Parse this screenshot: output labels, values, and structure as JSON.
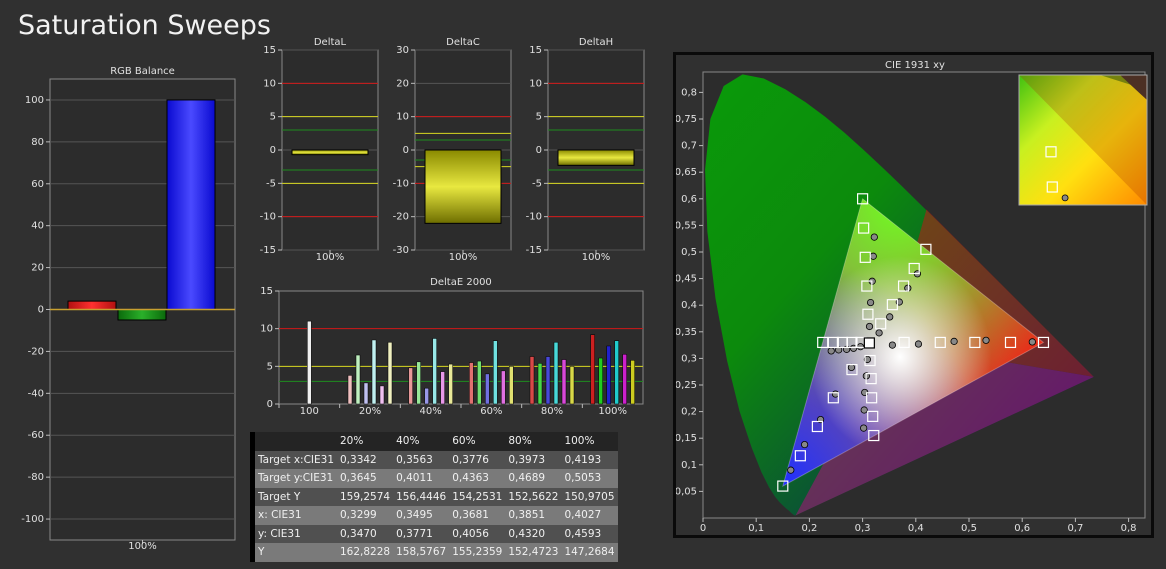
{
  "page": {
    "title": "Saturation Sweeps"
  },
  "colors": {
    "bg": "#303030",
    "plot_bg": "#2c2c2c",
    "red": "#e8231e",
    "green": "#1e8c1e",
    "blue": "#1414ff",
    "yellow": "#d8d820"
  },
  "chart_data": [
    {
      "type": "bar",
      "title": "RGB Balance",
      "categories": [
        "100%"
      ],
      "series": [
        {
          "values": [
            4
          ],
          "color": "#e8231e"
        },
        {
          "values": [
            -5
          ],
          "color": "#1e8c1e"
        },
        {
          "values": [
            100
          ],
          "color": "#1414ff"
        }
      ],
      "ylim": [
        -110,
        110
      ],
      "yticks": [
        "100",
        "80",
        "60",
        "40",
        "20",
        "0",
        "-20",
        "-40",
        "-60",
        "-80",
        "-100"
      ],
      "grid": true
    },
    {
      "type": "bar",
      "title": "DeltaL",
      "categories": [
        "100%"
      ],
      "values": [
        -0.7
      ],
      "ylim": [
        -15,
        15
      ],
      "yticks": [
        "15",
        "10",
        "5",
        "0",
        "-5",
        "-10",
        "-15"
      ],
      "ref_lines": {
        "red": [
          10,
          -10
        ],
        "yellow": [
          5,
          -5
        ],
        "green": [
          3,
          -3
        ]
      }
    },
    {
      "type": "bar",
      "title": "DeltaC",
      "categories": [
        "100%"
      ],
      "values": [
        -22
      ],
      "ylim": [
        -30,
        30
      ],
      "yticks": [
        "30",
        "20",
        "10",
        "0",
        "-10",
        "-20",
        "-30"
      ],
      "ref_lines": {
        "red": [
          10,
          -10
        ],
        "yellow": [
          5,
          -5
        ],
        "green": [
          3,
          -3
        ]
      }
    },
    {
      "type": "bar",
      "title": "DeltaH",
      "categories": [
        "100%"
      ],
      "values": [
        -2.3
      ],
      "ylim": [
        -15,
        15
      ],
      "yticks": [
        "15",
        "10",
        "5",
        "0",
        "-5",
        "-10",
        "-15"
      ],
      "ref_lines": {
        "red": [
          10,
          -10
        ],
        "yellow": [
          5,
          -5
        ],
        "green": [
          3,
          -3
        ]
      }
    },
    {
      "type": "bar",
      "title": "DeltaE 2000",
      "categories": [
        "100",
        "20%",
        "40%",
        "60%",
        "80%",
        "100%"
      ],
      "ylim": [
        0,
        15
      ],
      "yticks": [
        "15",
        "10",
        "5",
        "0"
      ],
      "ref_lines": {
        "red": [
          10
        ],
        "yellow": [
          5
        ],
        "green": [
          3
        ]
      },
      "groups": [
        {
          "values": [
            11
          ],
          "colors": [
            "#f0f0f0"
          ]
        },
        {
          "values": [
            3.8,
            6.5,
            2.8,
            8.5,
            2.4,
            8.2
          ],
          "colors": [
            "#f0c0c0",
            "#c0f0c0",
            "#c0c0f0",
            "#c0f0f0",
            "#f0c0f0",
            "#f0f0c0"
          ]
        },
        {
          "values": [
            4.8,
            5.6,
            2.1,
            8.7,
            4.3,
            5.3
          ],
          "colors": [
            "#e89898",
            "#98e898",
            "#9898e8",
            "#98e8e8",
            "#e898e8",
            "#e8e898"
          ]
        },
        {
          "values": [
            5.5,
            5.7,
            4.0,
            8.4,
            4.4,
            5.0
          ],
          "colors": [
            "#e07070",
            "#70e070",
            "#7070e0",
            "#70e0e0",
            "#e070e0",
            "#e0e070"
          ]
        },
        {
          "values": [
            6.3,
            5.4,
            6.3,
            8.2,
            5.9,
            5.0
          ],
          "colors": [
            "#d84848",
            "#48d848",
            "#4848d8",
            "#48d8d8",
            "#d848d8",
            "#d8d848"
          ]
        },
        {
          "values": [
            9.2,
            6.1,
            7.7,
            8.4,
            6.6,
            5.8
          ],
          "colors": [
            "#cc2020",
            "#20cc20",
            "#2020cc",
            "#20cccc",
            "#cc20cc",
            "#cccc20"
          ]
        }
      ]
    },
    {
      "type": "table",
      "columns": [
        "20%",
        "40%",
        "60%",
        "80%",
        "100%"
      ],
      "rows": [
        {
          "label": "Target x:CIE31",
          "values": [
            "0,3342",
            "0,3563",
            "0,3776",
            "0,3973",
            "0,4193"
          ]
        },
        {
          "label": "Target y:CIE31",
          "values": [
            "0,3645",
            "0,4011",
            "0,4363",
            "0,4689",
            "0,5053"
          ]
        },
        {
          "label": "Target Y",
          "values": [
            "159,2574",
            "156,4446",
            "154,2531",
            "152,5622",
            "150,9705"
          ]
        },
        {
          "label": "x: CIE31",
          "values": [
            "0,3299",
            "0,3495",
            "0,3681",
            "0,3851",
            "0,4027"
          ]
        },
        {
          "label": "y: CIE31",
          "values": [
            "0,3470",
            "0,3771",
            "0,4056",
            "0,4320",
            "0,4593"
          ]
        },
        {
          "label": "Y",
          "values": [
            "162,8228",
            "158,5767",
            "155,2359",
            "152,4723",
            "147,2684"
          ]
        }
      ]
    },
    {
      "type": "scatter",
      "title": "CIE 1931 xy",
      "xlim": [
        0,
        0.8
      ],
      "ylim": [
        0,
        0.8
      ],
      "xticks": [
        "0",
        "0,1",
        "0,2",
        "0,3",
        "0,4",
        "0,5",
        "0,6",
        "0,7",
        "0,8"
      ],
      "yticks": [
        "0,05",
        "0,1",
        "0,15",
        "0,2",
        "0,25",
        "0,3",
        "0,35",
        "0,4",
        "0,45",
        "0,5",
        "0,55",
        "0,6",
        "0,65",
        "0,7",
        "0,75",
        "0,8"
      ],
      "gamut": [
        [
          0.64,
          0.33
        ],
        [
          0.3,
          0.6
        ],
        [
          0.15,
          0.06
        ]
      ],
      "white_point": [
        0.3127,
        0.329
      ],
      "targets": [
        [
          0.64,
          0.33
        ],
        [
          0.578,
          0.33
        ],
        [
          0.511,
          0.33
        ],
        [
          0.446,
          0.33
        ],
        [
          0.378,
          0.33
        ],
        [
          0.3,
          0.6
        ],
        [
          0.302,
          0.545
        ],
        [
          0.305,
          0.49
        ],
        [
          0.308,
          0.436
        ],
        [
          0.31,
          0.383
        ],
        [
          0.15,
          0.06
        ],
        [
          0.183,
          0.117
        ],
        [
          0.215,
          0.172
        ],
        [
          0.245,
          0.226
        ],
        [
          0.28,
          0.279
        ],
        [
          0.225,
          0.33
        ],
        [
          0.245,
          0.33
        ],
        [
          0.262,
          0.33
        ],
        [
          0.28,
          0.33
        ],
        [
          0.297,
          0.33
        ],
        [
          0.419,
          0.505
        ],
        [
          0.397,
          0.469
        ],
        [
          0.377,
          0.436
        ],
        [
          0.356,
          0.401
        ],
        [
          0.334,
          0.365
        ],
        [
          0.321,
          0.155
        ],
        [
          0.319,
          0.191
        ],
        [
          0.317,
          0.226
        ],
        [
          0.316,
          0.262
        ],
        [
          0.314,
          0.296
        ]
      ],
      "measured": [
        [
          0.619,
          0.331
        ],
        [
          0.532,
          0.334
        ],
        [
          0.472,
          0.332
        ],
        [
          0.405,
          0.327
        ],
        [
          0.356,
          0.325
        ],
        [
          0.322,
          0.528
        ],
        [
          0.32,
          0.492
        ],
        [
          0.318,
          0.445
        ],
        [
          0.315,
          0.405
        ],
        [
          0.313,
          0.36
        ],
        [
          0.165,
          0.09
        ],
        [
          0.191,
          0.138
        ],
        [
          0.221,
          0.185
        ],
        [
          0.249,
          0.233
        ],
        [
          0.279,
          0.283
        ],
        [
          0.241,
          0.314
        ],
        [
          0.255,
          0.316
        ],
        [
          0.27,
          0.317
        ],
        [
          0.283,
          0.319
        ],
        [
          0.296,
          0.322
        ],
        [
          0.403,
          0.459
        ],
        [
          0.385,
          0.432
        ],
        [
          0.369,
          0.406
        ],
        [
          0.351,
          0.378
        ],
        [
          0.331,
          0.348
        ],
        [
          0.302,
          0.169
        ],
        [
          0.303,
          0.203
        ],
        [
          0.304,
          0.236
        ],
        [
          0.307,
          0.267
        ],
        [
          0.309,
          0.298
        ]
      ],
      "inset": {
        "targets": [
          [
            0.3,
            0.6
          ],
          [
            0.302,
            0.545
          ]
        ],
        "measured": [
          [
            0.322,
            0.528
          ]
        ]
      }
    }
  ]
}
